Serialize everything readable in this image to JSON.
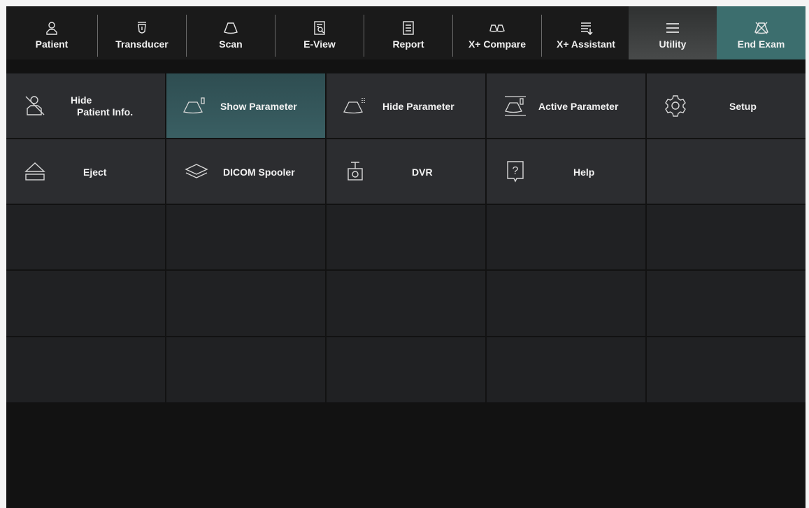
{
  "toolbar": {
    "items": [
      {
        "label": "Patient",
        "icon": "person-icon"
      },
      {
        "label": "Transducer",
        "icon": "transducer-icon"
      },
      {
        "label": "Scan",
        "icon": "scan-icon"
      },
      {
        "label": "E-View",
        "icon": "eview-icon"
      },
      {
        "label": "Report",
        "icon": "report-icon"
      },
      {
        "label": "X+ Compare",
        "icon": "compare-icon"
      },
      {
        "label": "X+ Assistant",
        "icon": "assistant-icon"
      },
      {
        "label": "Utility",
        "icon": "menu-icon"
      },
      {
        "label": "End Exam",
        "icon": "end-exam-icon"
      }
    ]
  },
  "utility": {
    "hide_patient_line1": "Hide",
    "hide_patient_line2": "Patient Info.",
    "show_parameter": "Show Parameter",
    "hide_parameter": "Hide Parameter",
    "active_parameter": "Active Parameter",
    "setup": "Setup",
    "eject": "Eject",
    "dicom_spooler": "DICOM Spooler",
    "dvr": "DVR",
    "help": "Help"
  },
  "colors": {
    "selected": "#3a5f63",
    "end_exam": "#3c6e6e",
    "cell": "#2c2d30",
    "empty_cell": "#202123"
  }
}
